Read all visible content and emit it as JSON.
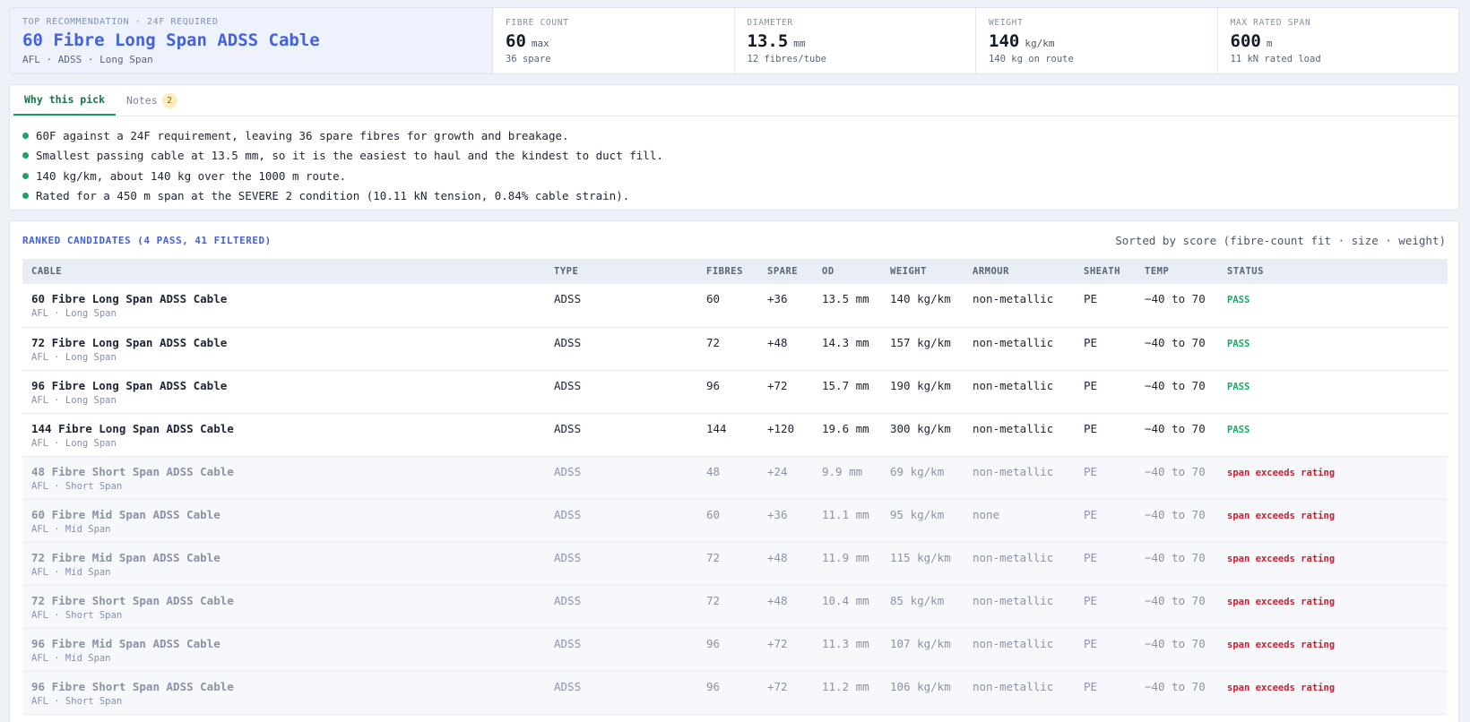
{
  "summary": {
    "kicker": "TOP RECOMMENDATION · 24F REQUIRED",
    "title": "60 Fibre Long Span ADSS Cable",
    "subtitle": "AFL · ADSS · Long Span",
    "stats": [
      {
        "label": "FIBRE COUNT",
        "value": "60",
        "unit": "max",
        "note": "36 spare"
      },
      {
        "label": "DIAMETER",
        "value": "13.5",
        "unit": "mm",
        "note": "12 fibres/tube"
      },
      {
        "label": "WEIGHT",
        "value": "140",
        "unit": "kg/km",
        "note": "140 kg on route"
      },
      {
        "label": "MAX RATED SPAN",
        "value": "600",
        "unit": "m",
        "note": "11 kN rated load"
      }
    ]
  },
  "why": {
    "tabs": [
      {
        "label": "Why this pick"
      },
      {
        "label": "Notes",
        "badge": "2"
      }
    ],
    "reasons": [
      "60F against a 24F requirement, leaving 36 spare fibres for growth and breakage.",
      "Smallest passing cable at 13.5 mm, so it is the easiest to haul and the kindest to duct fill.",
      "140 kg/km, about 140 kg over the 1000 m route.",
      "Rated for a 450 m span at the SEVERE 2 condition (10.11 kN tension, 0.84% cable strain)."
    ]
  },
  "candidates": {
    "title": "RANKED CANDIDATES (4 PASS, 41 FILTERED)",
    "sort_note": "Sorted by score (fibre-count fit · size · weight)",
    "columns": [
      "CABLE",
      "TYPE",
      "FIBRES",
      "SPARE",
      "OD",
      "WEIGHT",
      "ARMOUR",
      "SHEATH",
      "TEMP",
      "STATUS"
    ],
    "rows": [
      {
        "name": "60 Fibre Long Span ADSS Cable",
        "sub": "AFL · Long Span",
        "type": "ADSS",
        "fibres": "60",
        "spare": "+36",
        "od": "13.5 mm",
        "weight": "140 kg/km",
        "armour": "non-metallic",
        "sheath": "PE",
        "temp": "−40 to 70",
        "status": "PASS"
      },
      {
        "name": "72 Fibre Long Span ADSS Cable",
        "sub": "AFL · Long Span",
        "type": "ADSS",
        "fibres": "72",
        "spare": "+48",
        "od": "14.3 mm",
        "weight": "157 kg/km",
        "armour": "non-metallic",
        "sheath": "PE",
        "temp": "−40 to 70",
        "status": "PASS"
      },
      {
        "name": "96 Fibre Long Span ADSS Cable",
        "sub": "AFL · Long Span",
        "type": "ADSS",
        "fibres": "96",
        "spare": "+72",
        "od": "15.7 mm",
        "weight": "190 kg/km",
        "armour": "non-metallic",
        "sheath": "PE",
        "temp": "−40 to 70",
        "status": "PASS"
      },
      {
        "name": "144 Fibre Long Span ADSS Cable",
        "sub": "AFL · Long Span",
        "type": "ADSS",
        "fibres": "144",
        "spare": "+120",
        "od": "19.6 mm",
        "weight": "300 kg/km",
        "armour": "non-metallic",
        "sheath": "PE",
        "temp": "−40 to 70",
        "status": "PASS"
      },
      {
        "name": "48 Fibre Short Span ADSS Cable",
        "sub": "AFL · Short Span",
        "type": "ADSS",
        "fibres": "48",
        "spare": "+24",
        "od": "9.9 mm",
        "weight": "69 kg/km",
        "armour": "non-metallic",
        "sheath": "PE",
        "temp": "−40 to 70",
        "status": "span exceeds rating"
      },
      {
        "name": "60 Fibre Mid Span ADSS Cable",
        "sub": "AFL · Mid Span",
        "type": "ADSS",
        "fibres": "60",
        "spare": "+36",
        "od": "11.1 mm",
        "weight": "95 kg/km",
        "armour": "none",
        "sheath": "PE",
        "temp": "−40 to 70",
        "status": "span exceeds rating"
      },
      {
        "name": "72 Fibre Mid Span ADSS Cable",
        "sub": "AFL · Mid Span",
        "type": "ADSS",
        "fibres": "72",
        "spare": "+48",
        "od": "11.9 mm",
        "weight": "115 kg/km",
        "armour": "non-metallic",
        "sheath": "PE",
        "temp": "−40 to 70",
        "status": "span exceeds rating"
      },
      {
        "name": "72 Fibre Short Span ADSS Cable",
        "sub": "AFL · Short Span",
        "type": "ADSS",
        "fibres": "72",
        "spare": "+48",
        "od": "10.4 mm",
        "weight": "85 kg/km",
        "armour": "non-metallic",
        "sheath": "PE",
        "temp": "−40 to 70",
        "status": "span exceeds rating"
      },
      {
        "name": "96 Fibre Mid Span ADSS Cable",
        "sub": "AFL · Mid Span",
        "type": "ADSS",
        "fibres": "96",
        "spare": "+72",
        "od": "11.3 mm",
        "weight": "107 kg/km",
        "armour": "non-metallic",
        "sheath": "PE",
        "temp": "−40 to 70",
        "status": "span exceeds rating"
      },
      {
        "name": "96 Fibre Short Span ADSS Cable",
        "sub": "AFL · Short Span",
        "type": "ADSS",
        "fibres": "96",
        "spare": "+72",
        "od": "11.2 mm",
        "weight": "106 kg/km",
        "armour": "non-metallic",
        "sheath": "PE",
        "temp": "−40 to 70",
        "status": "span exceeds rating"
      }
    ]
  },
  "colors": {
    "accent": "#4361e0",
    "pass": "#1aa567",
    "fail": "#c4212f"
  }
}
